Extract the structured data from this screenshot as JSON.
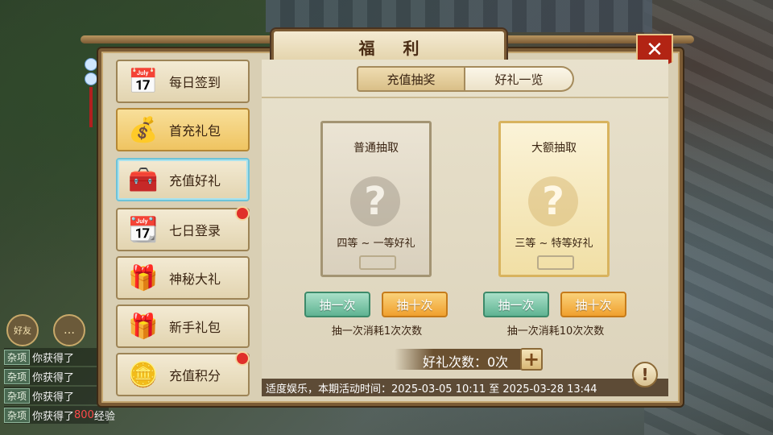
{
  "panel": {
    "title": "福 利"
  },
  "close": {
    "icon": "close-icon"
  },
  "sidebar": {
    "items": [
      {
        "label": "每日签到",
        "icon": "calendar-check-icon",
        "glyph": "📅",
        "red_dot": false
      },
      {
        "label": "首充礼包",
        "icon": "money-bag-icon",
        "glyph": "💰",
        "red_dot": false
      },
      {
        "label": "充值好礼",
        "icon": "treasure-chest-icon",
        "glyph": "🧰",
        "red_dot": false
      },
      {
        "label": "七日登录",
        "icon": "calendar-seven-icon",
        "glyph": "📆",
        "red_dot": true
      },
      {
        "label": "神秘大礼",
        "icon": "gold-chest-icon",
        "glyph": "🎁",
        "red_dot": false
      },
      {
        "label": "新手礼包",
        "icon": "gift-box-icon",
        "glyph": "🎁",
        "red_dot": false
      },
      {
        "label": "充值积分",
        "icon": "gold-coins-icon",
        "glyph": "🪙",
        "red_dot": true
      }
    ],
    "active_index": 1,
    "selected_index": 2
  },
  "tabs": [
    {
      "label": "充值抽奖",
      "active": true
    },
    {
      "label": "好礼一览",
      "active": false
    }
  ],
  "draws": [
    {
      "title": "普通抽取",
      "subtitle": "四等 ~ 一等好礼",
      "btn1": "抽一次",
      "btn2": "抽十次",
      "cost": "抽一次消耗1次次数"
    },
    {
      "title": "大额抽取",
      "subtitle": "三等 ~ 特等好礼",
      "btn1": "抽一次",
      "btn2": "抽十次",
      "cost": "抽一次消耗10次次数"
    }
  ],
  "count": {
    "label": "好礼次数：0次"
  },
  "footer": {
    "text": "适度娱乐，本期活动时间：2025-03-05 10:11 至 2025-03-28 13:44"
  },
  "hud": {
    "friend_label": "好友",
    "chat_icon": "chat-bubble-icon"
  },
  "chat": [
    {
      "tag": "杂项",
      "text": "你获得了",
      "highlight": ""
    },
    {
      "tag": "杂项",
      "text": "你获得了",
      "highlight": ""
    },
    {
      "tag": "杂项",
      "text": "你获得了",
      "highlight": ""
    },
    {
      "tag": "杂项",
      "text": "你获得了",
      "highlight": "800",
      "suffix": "经验"
    }
  ],
  "colors": {
    "accent_red": "#b22414",
    "gold": "#efc461",
    "green_btn": "#5fb392",
    "orange_btn": "#f0a02e"
  }
}
